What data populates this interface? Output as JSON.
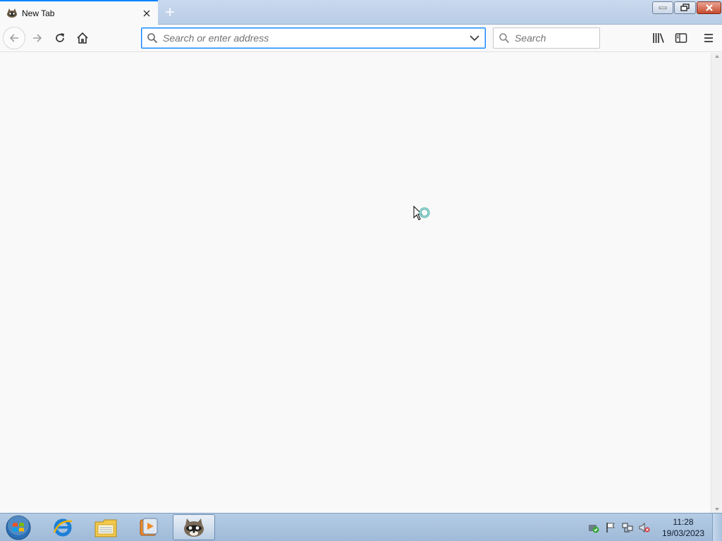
{
  "tab": {
    "title": "New Tab",
    "favicon": "raccoon-icon",
    "close_icon": "close-icon"
  },
  "newtab_icon": "plus-icon",
  "window_controls": {
    "minimize": "minimize-icon",
    "maximize": "restore-icon",
    "close": "close-icon"
  },
  "nav": {
    "back": "back-arrow-icon",
    "forward": "forward-arrow-icon",
    "reload": "reload-icon",
    "home": "home-icon"
  },
  "urlbar": {
    "placeholder": "Search or enter address",
    "value": ""
  },
  "searchbar": {
    "placeholder": "Search",
    "value": ""
  },
  "toolbar_right": {
    "library": "library-icon",
    "sidebar": "sidebar-icon",
    "menu": "hamburger-menu-icon"
  },
  "taskbar": {
    "start": "windows-start-icon",
    "apps": [
      "internet-explorer-icon",
      "file-explorer-icon",
      "media-player-icon",
      "raccoon-browser-icon"
    ],
    "tray": [
      "security-shield-icon",
      "action-center-flag-icon",
      "network-icon",
      "volume-muted-icon"
    ],
    "time": "11:28",
    "date": "19/03/2023"
  },
  "colors": {
    "accent": "#0a84ff",
    "content_bg": "#f9f9fa",
    "taskbar": "#a9c2de"
  }
}
